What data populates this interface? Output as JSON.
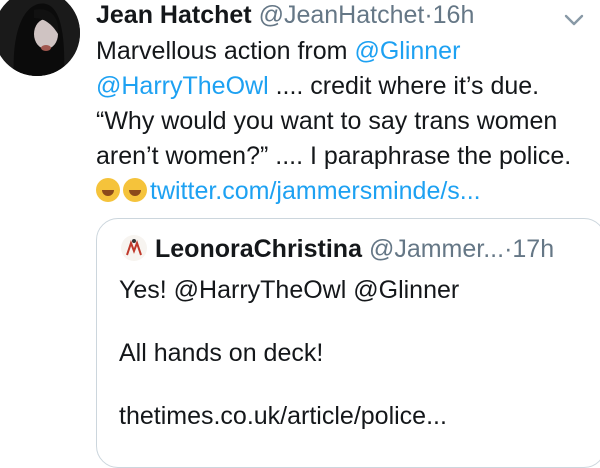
{
  "tweet": {
    "display_name": "Jean Hatchet",
    "handle": "@JeanHatchet",
    "separator": "·",
    "time": "16h",
    "lines": [
      {
        "pre": "Marvellous action from ",
        "mention": "@Glinner",
        "post": ""
      },
      {
        "pre": "",
        "mention": "@HarryTheOwl",
        "post": " .... credit where it’s due."
      },
      {
        "pre": "“Why would you want to say trans women",
        "mention": "",
        "post": ""
      },
      {
        "pre": "aren’t women?” .... I paraphrase the police.",
        "mention": "",
        "post": ""
      }
    ],
    "emoji_names": [
      "rolling-on-floor-laughing-emoji",
      "rolling-on-floor-laughing-emoji"
    ],
    "link": "twitter.com/jammersminde/s..."
  },
  "quoted": {
    "display_name": "LeonoraChristina",
    "handle": "@Jammer...",
    "separator": "·",
    "time": "17h",
    "body": [
      "Yes! @HarryTheOwl @Glinner",
      "All hands on deck!",
      "thetimes.co.uk/article/police..."
    ]
  },
  "icons": {
    "more": "chevron-down-icon",
    "avatar": "avatar-image",
    "quoted_avatar": "quoted-avatar-image"
  },
  "colors": {
    "text": "#14171a",
    "secondary": "#657786",
    "link": "#1da1f2",
    "border": "#ccd6dd"
  }
}
